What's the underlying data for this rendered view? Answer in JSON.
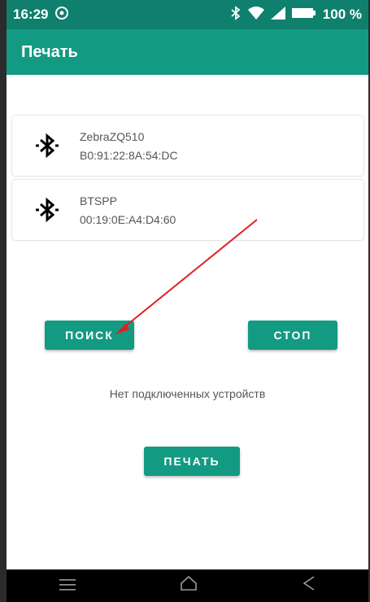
{
  "statusbar": {
    "time": "16:29",
    "battery": "100 %"
  },
  "appbar": {
    "title": "Печать"
  },
  "devices": [
    {
      "name": "ZebraZQ510",
      "mac": "B0:91:22:8A:54:DC"
    },
    {
      "name": "BTSPP",
      "mac": "00:19:0E:A4:D4:60"
    }
  ],
  "buttons": {
    "search": "ПОИСК",
    "stop": "СТОП",
    "print": "ПЕЧАТЬ"
  },
  "status_text": "Нет подключенных устройств",
  "icons": [
    "bluetooth-icon",
    "wifi-icon",
    "signal-icon",
    "battery-icon",
    "menu-icon",
    "home-icon",
    "back-icon"
  ],
  "colors": {
    "primary": "#139a83",
    "primary_dark": "#0f806d",
    "annotation": "#e02020"
  }
}
